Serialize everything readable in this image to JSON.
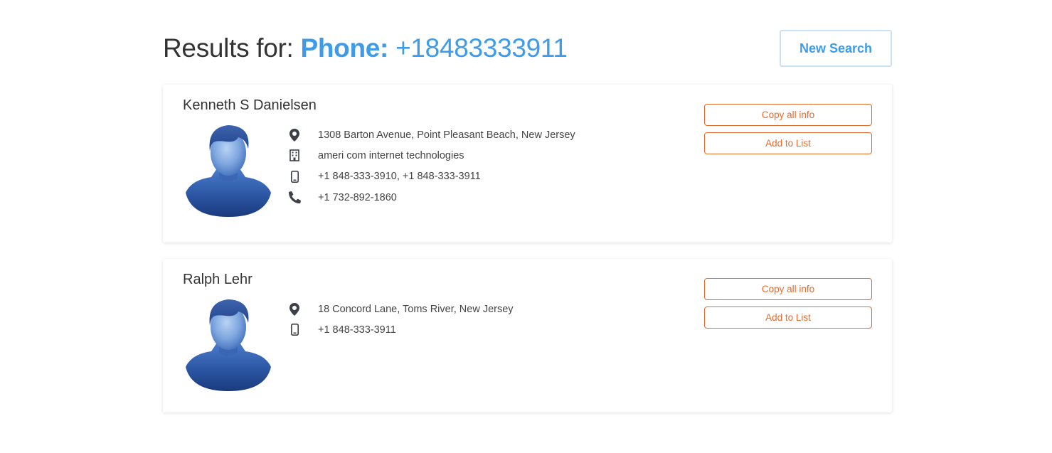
{
  "header": {
    "title_prefix": "Results for: ",
    "title_key": "Phone:",
    "title_value": " +18483333911",
    "new_search_label": "New Search"
  },
  "colors": {
    "accent": "#3d9be9",
    "action": "#e56b2e",
    "avatar": "#2f5aa5"
  },
  "results": [
    {
      "name": "Kenneth S Danielsen",
      "address": "1308 Barton Avenue, Point Pleasant Beach, New Jersey",
      "company": "ameri com internet technologies",
      "mobile": "+1 848-333-3910,  +1 848-333-3911",
      "landline": "+1 732-892-1860",
      "copy_label": "Copy all info",
      "add_label": "Add to List",
      "icons": [
        "map-marker-icon",
        "building-icon",
        "mobile-phone-icon",
        "phone-icon"
      ]
    },
    {
      "name": "Ralph Lehr",
      "address": "18 Concord Lane, Toms River, New Jersey",
      "mobile": "+1 848-333-3911",
      "copy_label": "Copy all info",
      "add_label": "Add to List",
      "icons": [
        "map-marker-icon",
        "mobile-phone-icon"
      ]
    }
  ]
}
